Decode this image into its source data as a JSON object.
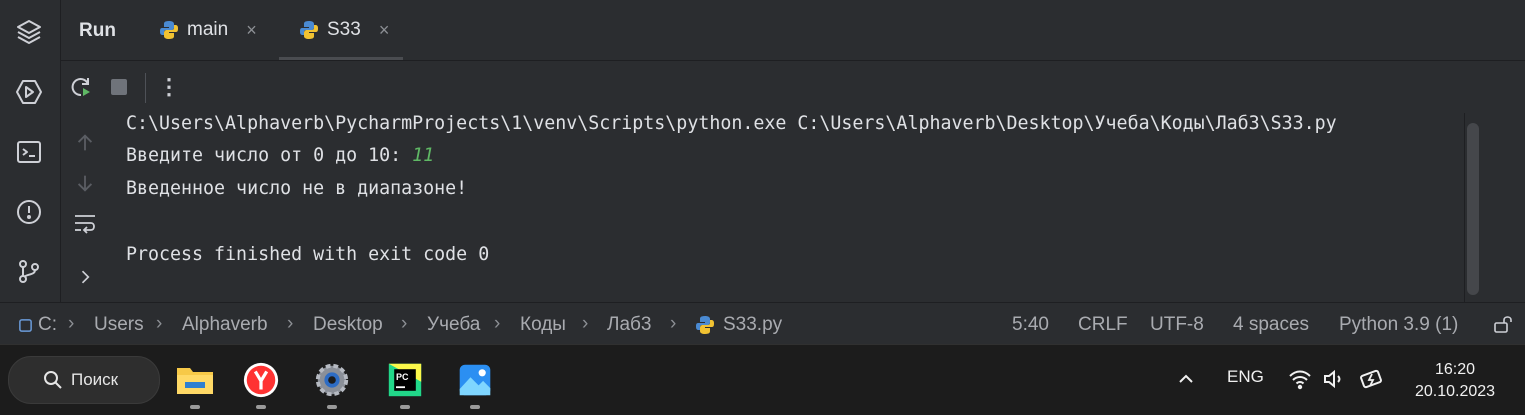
{
  "toolstrip": {
    "items": [
      {
        "icon": "layers-icon"
      },
      {
        "icon": "run-services-icon"
      },
      {
        "icon": "terminal-icon"
      },
      {
        "icon": "problems-icon"
      },
      {
        "icon": "git-branch-icon"
      }
    ]
  },
  "topbar": {
    "title": "Run",
    "tabs": [
      {
        "label": "main",
        "close": "×"
      },
      {
        "label": "S33",
        "close": "×"
      }
    ]
  },
  "runbar": {
    "more": "⋮"
  },
  "console": {
    "lines": {
      "command": "C:\\Users\\Alphaverb\\PycharmProjects\\1\\venv\\Scripts\\python.exe C:\\Users\\Alphaverb\\Desktop\\Учеба\\Коды\\Лаб3\\S33.py",
      "prompt": "Введите число от 0 до 10: ",
      "input": "11",
      "result": "Введенное число не в диапазоне!",
      "finished": "Process finished with exit code 0"
    }
  },
  "statusbar": {
    "breadcrumb": [
      "C:",
      "Users",
      "Alphaverb",
      "Desktop",
      "Учеба",
      "Коды",
      "Лаб3",
      "S33.py"
    ],
    "position": "5:40",
    "line_sep": "CRLF",
    "encoding": "UTF-8",
    "indent": "4 spaces",
    "interpreter": "Python 3.9 (1)"
  },
  "taskbar": {
    "search_label": "Поиск",
    "lang": "ENG",
    "time": "16:20",
    "date": "20.10.2023"
  },
  "colors": {
    "input_green": "#5fb865",
    "panel": "#2b2d30",
    "background": "#1e1f22"
  }
}
